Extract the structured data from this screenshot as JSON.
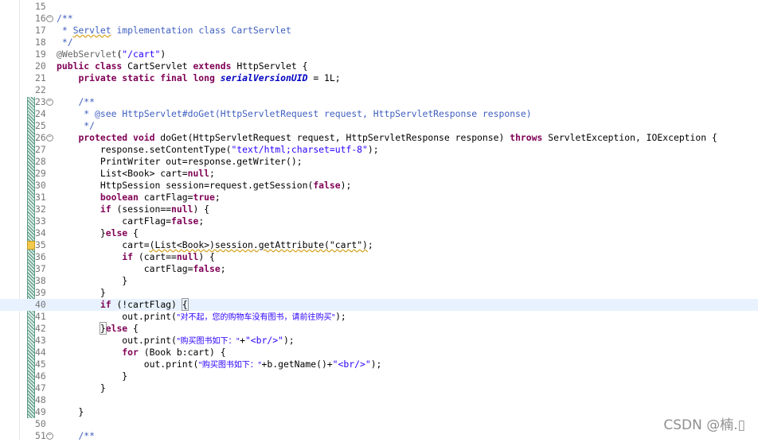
{
  "editor": {
    "lines": [
      {
        "n": "15",
        "parts": []
      },
      {
        "n": "16",
        "fold": true,
        "parts": [
          {
            "c": "cm",
            "t": "/**"
          }
        ]
      },
      {
        "n": "17",
        "parts": [
          {
            "c": "cm",
            "t": " * "
          },
          {
            "c": "cm warnsq",
            "t": "Servlet"
          },
          {
            "c": "cm",
            "t": " implementation class CartServlet"
          }
        ]
      },
      {
        "n": "18",
        "parts": [
          {
            "c": "cm",
            "t": " */"
          }
        ]
      },
      {
        "n": "19",
        "parts": [
          {
            "c": "ann",
            "t": "@WebServlet"
          },
          {
            "c": "",
            "t": "("
          },
          {
            "c": "str",
            "t": "\"/cart\""
          },
          {
            "c": "",
            "t": ")"
          }
        ]
      },
      {
        "n": "20",
        "parts": [
          {
            "c": "kw",
            "t": "public class"
          },
          {
            "c": "",
            "t": " CartServlet "
          },
          {
            "c": "kw",
            "t": "extends"
          },
          {
            "c": "",
            "t": " HttpServlet {"
          }
        ]
      },
      {
        "n": "21",
        "parts": [
          {
            "c": "",
            "t": "    "
          },
          {
            "c": "kw",
            "t": "private static final long"
          },
          {
            "c": "",
            "t": " "
          },
          {
            "c": "fld",
            "t": "serialVersionUID"
          },
          {
            "c": "",
            "t": " = 1L;"
          }
        ]
      },
      {
        "n": "22",
        "parts": []
      },
      {
        "n": "23",
        "fold": true,
        "parts": [
          {
            "c": "",
            "t": "    "
          },
          {
            "c": "cm",
            "t": "/**"
          }
        ]
      },
      {
        "n": "24",
        "parts": [
          {
            "c": "cm",
            "t": "     * @see HttpServlet#doGet(HttpServletRequest request, HttpServletResponse response)"
          }
        ]
      },
      {
        "n": "25",
        "parts": [
          {
            "c": "cm",
            "t": "     */"
          }
        ]
      },
      {
        "n": "26",
        "fold": true,
        "parts": [
          {
            "c": "",
            "t": "    "
          },
          {
            "c": "kw",
            "t": "protected void"
          },
          {
            "c": "",
            "t": " doGet(HttpServletRequest request, HttpServletResponse response) "
          },
          {
            "c": "kw",
            "t": "throws"
          },
          {
            "c": "",
            "t": " ServletException, IOException {"
          }
        ]
      },
      {
        "n": "27",
        "parts": [
          {
            "c": "",
            "t": "        response.setContentType("
          },
          {
            "c": "str",
            "t": "\"text/html;charset=utf-8\""
          },
          {
            "c": "",
            "t": ");"
          }
        ]
      },
      {
        "n": "28",
        "parts": [
          {
            "c": "",
            "t": "        PrintWriter out=response.getWriter();"
          }
        ]
      },
      {
        "n": "29",
        "parts": [
          {
            "c": "",
            "t": "        List<Book> cart="
          },
          {
            "c": "kw",
            "t": "null"
          },
          {
            "c": "",
            "t": ";"
          }
        ]
      },
      {
        "n": "30",
        "parts": [
          {
            "c": "",
            "t": "        HttpSession session=request.getSession("
          },
          {
            "c": "kw",
            "t": "false"
          },
          {
            "c": "",
            "t": ");"
          }
        ]
      },
      {
        "n": "31",
        "parts": [
          {
            "c": "",
            "t": "        "
          },
          {
            "c": "kw",
            "t": "boolean"
          },
          {
            "c": "",
            "t": " cartFlag="
          },
          {
            "c": "kw",
            "t": "true"
          },
          {
            "c": "",
            "t": ";"
          }
        ]
      },
      {
        "n": "32",
        "parts": [
          {
            "c": "",
            "t": "        "
          },
          {
            "c": "kw",
            "t": "if"
          },
          {
            "c": "",
            "t": " (session=="
          },
          {
            "c": "kw",
            "t": "null"
          },
          {
            "c": "",
            "t": ") {"
          }
        ]
      },
      {
        "n": "33",
        "parts": [
          {
            "c": "",
            "t": "            cartFlag="
          },
          {
            "c": "kw",
            "t": "false"
          },
          {
            "c": "",
            "t": ";"
          }
        ]
      },
      {
        "n": "34",
        "parts": [
          {
            "c": "",
            "t": "        }"
          },
          {
            "c": "kw",
            "t": "else"
          },
          {
            "c": "",
            "t": " {"
          }
        ]
      },
      {
        "n": "35",
        "warn": true,
        "parts": [
          {
            "c": "",
            "t": "            cart="
          },
          {
            "c": "warnsq",
            "t": "(List<Book>)session.getAttribute(\"cart\")"
          },
          {
            "c": "",
            "t": ";"
          }
        ]
      },
      {
        "n": "36",
        "parts": [
          {
            "c": "",
            "t": "            "
          },
          {
            "c": "kw",
            "t": "if"
          },
          {
            "c": "",
            "t": " (cart=="
          },
          {
            "c": "kw",
            "t": "null"
          },
          {
            "c": "",
            "t": ") {"
          }
        ]
      },
      {
        "n": "37",
        "parts": [
          {
            "c": "",
            "t": "                cartFlag="
          },
          {
            "c": "kw",
            "t": "false"
          },
          {
            "c": "",
            "t": ";"
          }
        ]
      },
      {
        "n": "38",
        "parts": [
          {
            "c": "",
            "t": "            }"
          }
        ]
      },
      {
        "n": "39",
        "parts": [
          {
            "c": "",
            "t": "        }"
          }
        ]
      },
      {
        "n": "40",
        "current": true,
        "parts": [
          {
            "c": "",
            "t": "        "
          },
          {
            "c": "kw",
            "t": "if"
          },
          {
            "c": "",
            "t": " (!cartFlag) "
          },
          {
            "c": "brk",
            "t": "{"
          },
          {
            "c": "caret",
            "t": ""
          }
        ]
      },
      {
        "n": "41",
        "parts": [
          {
            "c": "",
            "t": "            out.print("
          },
          {
            "c": "str cjk",
            "t": "\"对不起，您的购物车没有图书，请前往购买\""
          },
          {
            "c": "",
            "t": ");"
          }
        ]
      },
      {
        "n": "42",
        "parts": [
          {
            "c": "",
            "t": "        "
          },
          {
            "c": "brk",
            "t": "}"
          },
          {
            "c": "kw",
            "t": "else"
          },
          {
            "c": "",
            "t": " {"
          }
        ]
      },
      {
        "n": "43",
        "parts": [
          {
            "c": "",
            "t": "            out.print("
          },
          {
            "c": "str cjk",
            "t": "\"购买图书如下：\""
          },
          {
            "c": "",
            "t": "+"
          },
          {
            "c": "str",
            "t": "\"<br/>\""
          },
          {
            "c": "",
            "t": ");"
          }
        ]
      },
      {
        "n": "44",
        "parts": [
          {
            "c": "",
            "t": "            "
          },
          {
            "c": "kw",
            "t": "for"
          },
          {
            "c": "",
            "t": " (Book b:cart) {"
          }
        ]
      },
      {
        "n": "45",
        "parts": [
          {
            "c": "",
            "t": "                out.print("
          },
          {
            "c": "str cjk",
            "t": "\"购买图书如下：\""
          },
          {
            "c": "",
            "t": "+b.getName()+"
          },
          {
            "c": "str",
            "t": "\"<br/>\""
          },
          {
            "c": "",
            "t": ");"
          }
        ]
      },
      {
        "n": "46",
        "parts": [
          {
            "c": "",
            "t": "            }"
          }
        ]
      },
      {
        "n": "47",
        "parts": [
          {
            "c": "",
            "t": "        }"
          }
        ]
      },
      {
        "n": "48",
        "parts": []
      },
      {
        "n": "49",
        "parts": [
          {
            "c": "",
            "t": "    }"
          }
        ]
      },
      {
        "n": "50",
        "parts": []
      },
      {
        "n": "51",
        "fold": true,
        "parts": [
          {
            "c": "",
            "t": "    "
          },
          {
            "c": "cm",
            "t": "/**"
          }
        ]
      }
    ]
  },
  "watermark": "CSDN @楠.▯",
  "colors": {
    "keyword": "#7f0055",
    "string": "#2a00ff",
    "comment": "#3f5fbf",
    "annotation": "#646464",
    "field": "#0000c0",
    "current_line": "#e8f2fe"
  },
  "icons": {
    "fold": "fold-collapse-icon",
    "warning": "warning-marker-icon",
    "coverage": "coverage-bar"
  }
}
